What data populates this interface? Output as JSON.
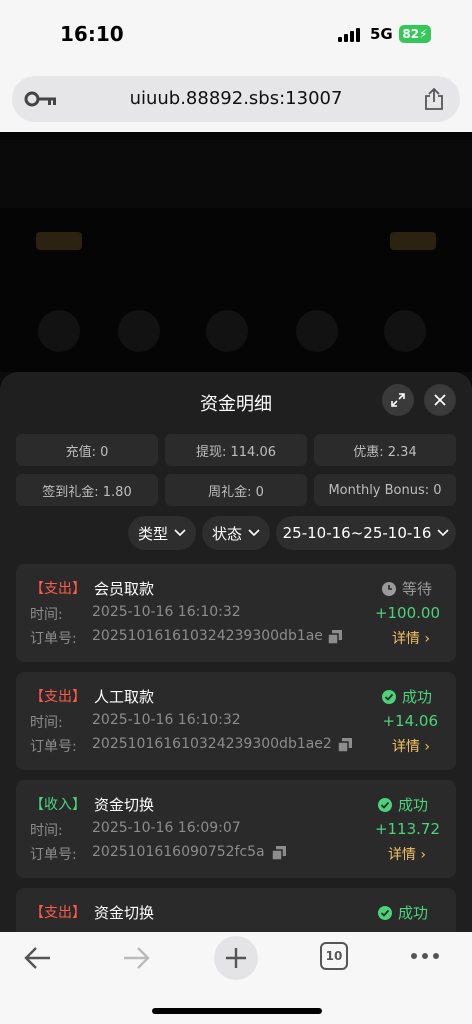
{
  "status_bar": {
    "time": "16:10",
    "network": "5G",
    "battery": "82"
  },
  "browser": {
    "url": "uiuub.88892.sbs:13007",
    "tab_count": "10"
  },
  "sheet": {
    "title": "资金明细",
    "stats": [
      {
        "label": "充值: 0"
      },
      {
        "label": "提现: 114.06"
      },
      {
        "label": "优惠: 2.34"
      },
      {
        "label": "签到礼金: 1.80"
      },
      {
        "label": "周礼金: 0"
      },
      {
        "label": "Monthly Bonus: 0"
      }
    ],
    "filters": {
      "type": "类型",
      "status": "状态",
      "date_range": "25-10-16~25-10-16"
    },
    "time_label": "时间:",
    "order_label": "订单号:",
    "detail_label": "详情",
    "transactions": [
      {
        "tag": "【支出】",
        "tag_color": "#ff5a4a",
        "title": "会员取款",
        "time": "2025-10-16 16:10:32",
        "order": "20251016161032423930 0db1ae",
        "order_id": "202510161610324239300db1ae",
        "status": "等待",
        "status_color": "#9a9a9a",
        "amount": "+100.00"
      },
      {
        "tag": "【支出】",
        "tag_color": "#ff5a4a",
        "title": "人工取款",
        "time": "2025-10-16 16:10:32",
        "order_id": "202510161610324239300db1ae2",
        "status": "成功",
        "status_color": "#4cd37a",
        "amount": "+14.06"
      },
      {
        "tag": "【收入】",
        "tag_color": "#4cd37a",
        "title": "资金切换",
        "time": "2025-10-16 16:09:07",
        "order_id": "2025101616090752fc5a",
        "status": "成功",
        "status_color": "#4cd37a",
        "amount": "+113.72"
      },
      {
        "tag": "【支出】",
        "tag_color": "#ff5a4a",
        "title": "资金切换",
        "status": "成功",
        "status_color": "#4cd37a"
      }
    ]
  }
}
